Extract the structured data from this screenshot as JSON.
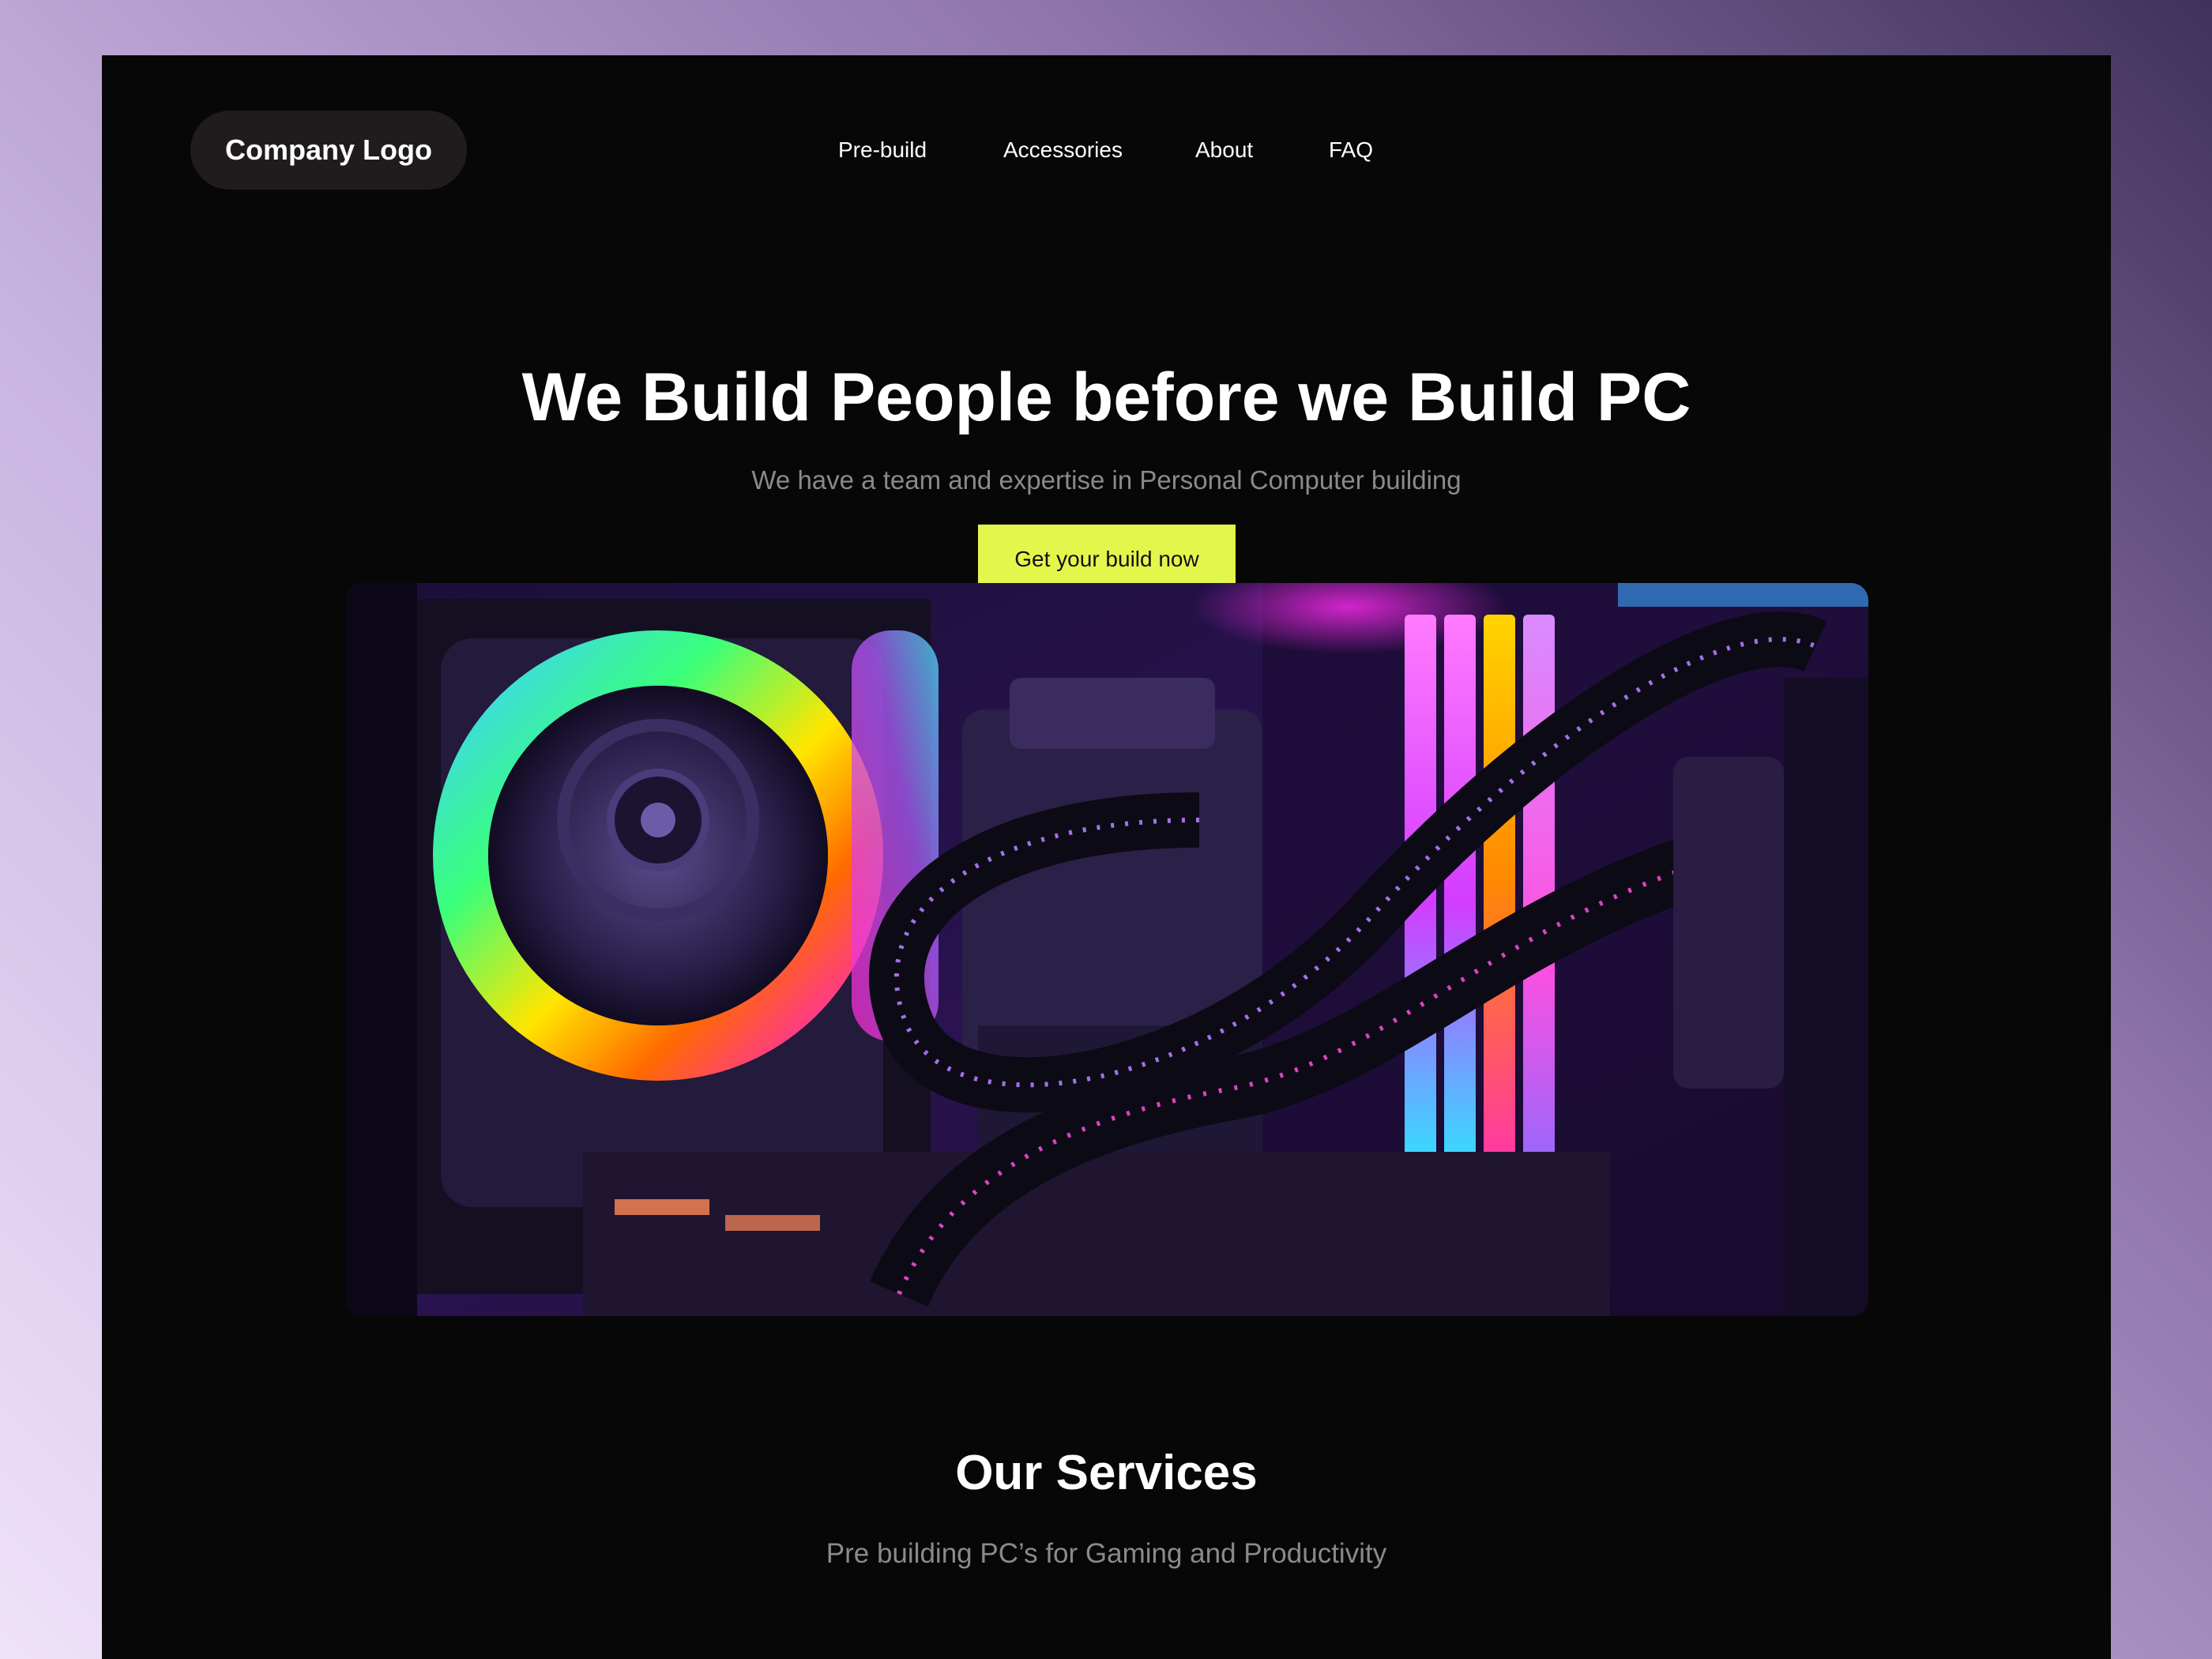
{
  "header": {
    "logo_text": "Company Logo",
    "nav": [
      {
        "label": "Pre-build"
      },
      {
        "label": "Accessories"
      },
      {
        "label": "About"
      },
      {
        "label": "FAQ"
      }
    ]
  },
  "hero": {
    "title": "We Build People before we Build PC",
    "subtitle": "We have a team and expertise in Personal Computer building",
    "cta_label": "Get your build now",
    "image_icon": "rgb-pc-build-photo"
  },
  "services": {
    "title": "Our Services",
    "subtitle": "Pre building PC’s for Gaming and Productivity"
  },
  "colors": {
    "page_bg": "#070707",
    "accent": "#e3f64c",
    "logo_pill_bg": "#201c1d",
    "muted_text": "#8a8a8e"
  }
}
